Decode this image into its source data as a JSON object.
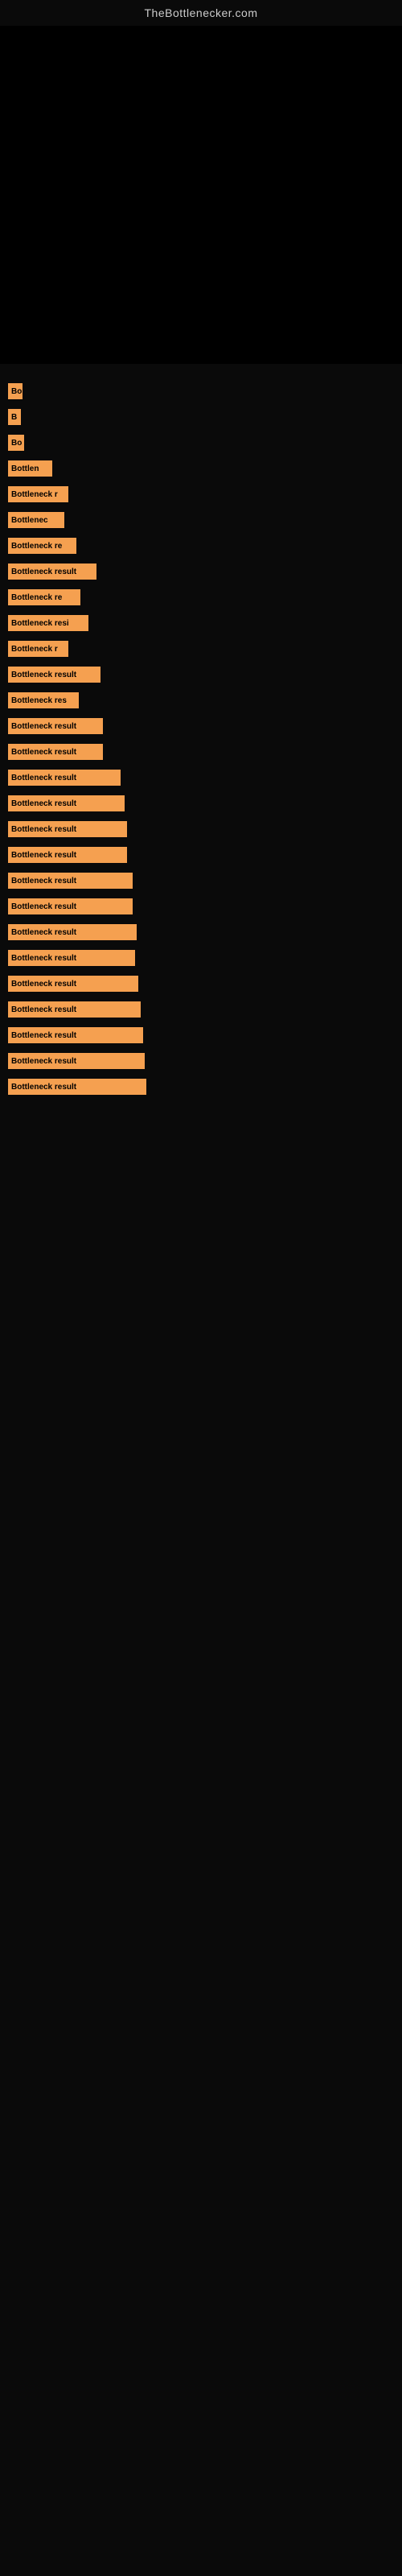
{
  "site": {
    "title": "TheBottlenecker.com"
  },
  "bars": [
    {
      "label": "Bottleneck result",
      "width": 18,
      "text": "Bo"
    },
    {
      "label": "Bottleneck result",
      "width": 16,
      "text": "B"
    },
    {
      "label": "Bottleneck result",
      "width": 20,
      "text": "Bo"
    },
    {
      "label": "Bottleneck result",
      "width": 55,
      "text": "Bottlen"
    },
    {
      "label": "Bottleneck result",
      "width": 75,
      "text": "Bottleneck r"
    },
    {
      "label": "Bottleneck result",
      "width": 70,
      "text": "Bottlenec"
    },
    {
      "label": "Bottleneck result",
      "width": 85,
      "text": "Bottleneck re"
    },
    {
      "label": "Bottleneck result",
      "width": 110,
      "text": "Bottleneck result"
    },
    {
      "label": "Bottleneck result",
      "width": 90,
      "text": "Bottleneck re"
    },
    {
      "label": "Bottleneck result",
      "width": 100,
      "text": "Bottleneck resi"
    },
    {
      "label": "Bottleneck result",
      "width": 75,
      "text": "Bottleneck r"
    },
    {
      "label": "Bottleneck result",
      "width": 115,
      "text": "Bottleneck result"
    },
    {
      "label": "Bottleneck result",
      "width": 88,
      "text": "Bottleneck res"
    },
    {
      "label": "Bottleneck result",
      "width": 118,
      "text": "Bottleneck result"
    },
    {
      "label": "Bottleneck result",
      "width": 118,
      "text": "Bottleneck result"
    },
    {
      "label": "Bottleneck result",
      "width": 140,
      "text": "Bottleneck result"
    },
    {
      "label": "Bottleneck result",
      "width": 145,
      "text": "Bottleneck result"
    },
    {
      "label": "Bottleneck result",
      "width": 148,
      "text": "Bottleneck result"
    },
    {
      "label": "Bottleneck result",
      "width": 148,
      "text": "Bottleneck result"
    },
    {
      "label": "Bottleneck result",
      "width": 155,
      "text": "Bottleneck result"
    },
    {
      "label": "Bottleneck result",
      "width": 155,
      "text": "Bottleneck result"
    },
    {
      "label": "Bottleneck result",
      "width": 160,
      "text": "Bottleneck result"
    },
    {
      "label": "Bottleneck result",
      "width": 158,
      "text": "Bottleneck result"
    },
    {
      "label": "Bottleneck result",
      "width": 162,
      "text": "Bottleneck result"
    },
    {
      "label": "Bottleneck result",
      "width": 165,
      "text": "Bottleneck result"
    },
    {
      "label": "Bottleneck result",
      "width": 168,
      "text": "Bottleneck result"
    },
    {
      "label": "Bottleneck result",
      "width": 170,
      "text": "Bottleneck result"
    },
    {
      "label": "Bottleneck result",
      "width": 172,
      "text": "Bottleneck result"
    }
  ]
}
